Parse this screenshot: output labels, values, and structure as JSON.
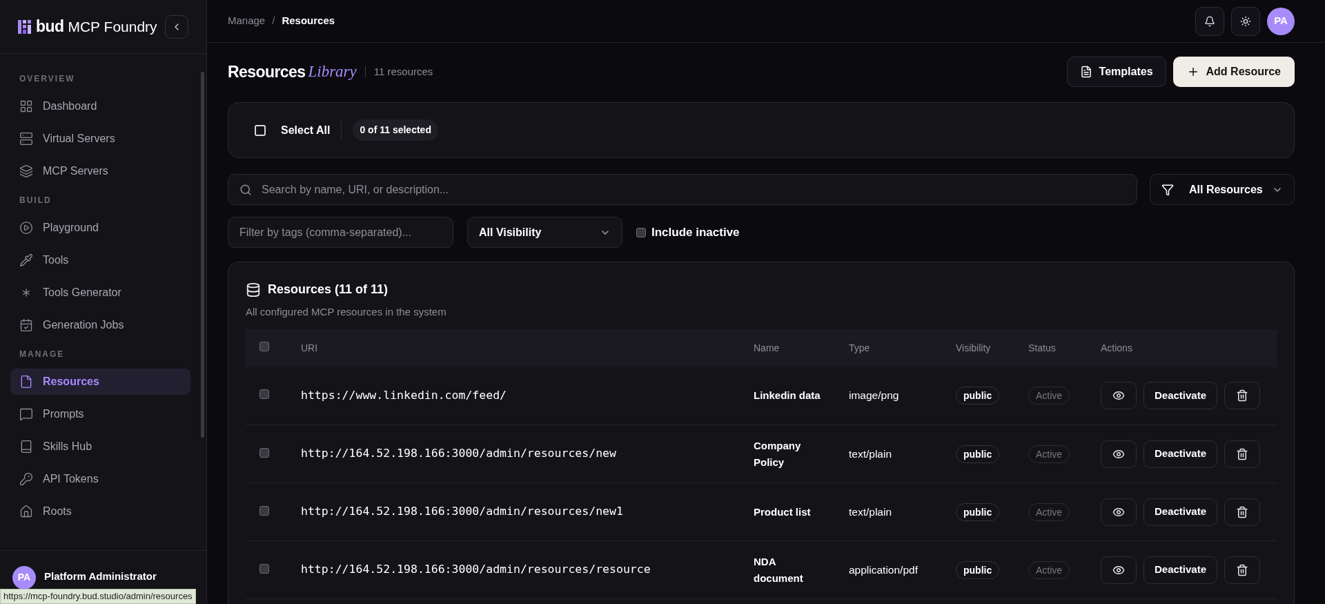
{
  "sidebar": {
    "brand": {
      "mark": "bud",
      "name": "MCP Foundry"
    },
    "sections": [
      {
        "label": "OVERVIEW",
        "items": [
          {
            "label": "Dashboard",
            "selected": false
          },
          {
            "label": "Virtual Servers",
            "selected": false
          },
          {
            "label": "MCP Servers",
            "selected": false
          }
        ]
      },
      {
        "label": "BUILD",
        "items": [
          {
            "label": "Playground",
            "selected": false
          },
          {
            "label": "Tools",
            "selected": false
          },
          {
            "label": "Tools Generator",
            "selected": false
          },
          {
            "label": "Generation Jobs",
            "selected": false
          }
        ]
      },
      {
        "label": "MANAGE",
        "items": [
          {
            "label": "Resources",
            "selected": true
          },
          {
            "label": "Prompts",
            "selected": false
          },
          {
            "label": "Skills Hub",
            "selected": false
          },
          {
            "label": "API Tokens",
            "selected": false
          },
          {
            "label": "Roots",
            "selected": false
          }
        ]
      }
    ],
    "user": {
      "initials": "PA",
      "name": "Platform Administrator"
    }
  },
  "header": {
    "breadcrumb": [
      "Manage",
      "Resources"
    ],
    "separator": "/",
    "avatar": "PA"
  },
  "page": {
    "title": "Resources",
    "title_accent": "Library",
    "count": "11 resources",
    "buttons": [
      "Templates",
      "Add Resource"
    ]
  },
  "selection": {
    "label": "Select All",
    "checked": false,
    "count": "0 of 11 selected"
  },
  "search": {
    "placeholder": "Search by name, URI, or description..."
  },
  "type_filter": {
    "value": "All Resources"
  },
  "filters": {
    "tags_placeholder": "Filter by tags (comma-separated)...",
    "visibility": "All Visibility",
    "include_inactive": {
      "label": "Include inactive",
      "checked": false
    }
  },
  "table": {
    "title": "Resources (11 of 11)",
    "subtitle": "All configured MCP resources in the system",
    "columns": [
      "URI",
      "Name",
      "Type",
      "Visibility",
      "Status",
      "Actions"
    ],
    "rows": [
      {
        "selected": false,
        "uri": "https://www.linkedin.com/feed/",
        "name": "Linkedin data",
        "type": "image/png",
        "visibility": "public",
        "status": "Active",
        "action": "Deactivate"
      },
      {
        "selected": false,
        "uri": "http://164.52.198.166:3000/admin/resources/new",
        "name": "Company Policy",
        "type": "text/plain",
        "visibility": "public",
        "status": "Active",
        "action": "Deactivate"
      },
      {
        "selected": false,
        "uri": "http://164.52.198.166:3000/admin/resources/new1",
        "name": "Product list",
        "type": "text/plain",
        "visibility": "public",
        "status": "Active",
        "action": "Deactivate"
      },
      {
        "selected": false,
        "uri": "http://164.52.198.166:3000/admin/resources/resource",
        "name": "NDA document",
        "type": "application/pdf",
        "visibility": "public",
        "status": "Active",
        "action": "Deactivate"
      }
    ]
  },
  "link_preview": "https://mcp-foundry.bud.studio/admin/resources"
}
